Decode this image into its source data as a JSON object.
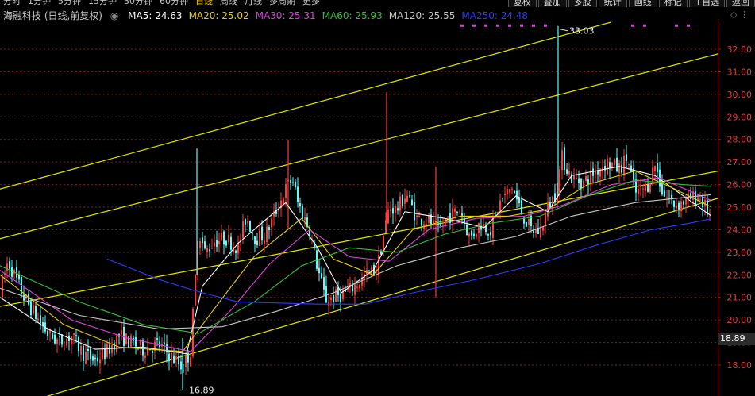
{
  "header": {
    "period_tabs": [
      "分时",
      "1分钟",
      "5分钟",
      "15分钟",
      "30分钟",
      "60分钟",
      "日线",
      "周线",
      "月线",
      "多周期",
      "更多"
    ],
    "active_tab": "日线",
    "tools": [
      "复权",
      "叠加",
      "多股",
      "统计",
      "画线",
      "标记",
      "+自选",
      "返回"
    ]
  },
  "legend": {
    "title": "海融科技 (日线,前复权)",
    "items": [
      {
        "label": "MA5: 24.63",
        "color": "#ffffff"
      },
      {
        "label": "MA20: 25.02",
        "color": "#e8d000"
      },
      {
        "label": "MA30: 25.31",
        "color": "#e040e0"
      },
      {
        "label": "MA60: 25.93",
        "color": "#30c030"
      },
      {
        "label": "MA120: 25.55",
        "color": "#c8c8c8"
      },
      {
        "label": "MA250: 24.48",
        "color": "#2a3cff"
      }
    ]
  },
  "price_tag": "18.89",
  "chart_data": {
    "type": "candlestick",
    "ylim": [
      17.0,
      33.5
    ],
    "y_ticks": [
      "18.00",
      "19.00",
      "20.00",
      "21.00",
      "22.00",
      "23.00",
      "24.00",
      "25.00",
      "26.00",
      "27.00",
      "28.00",
      "29.00",
      "30.00",
      "31.00",
      "32.00"
    ],
    "annotations": {
      "high": "33.03",
      "low": "16.89"
    },
    "colors": {
      "up": "#ff3b3b",
      "down": "#54ffff",
      "grid": "#7a1f1f",
      "channel": "#e6e600"
    },
    "price_path": [
      [
        0,
        21.2
      ],
      [
        10,
        22.6
      ],
      [
        18,
        22.0
      ],
      [
        30,
        21.0
      ],
      [
        45,
        20.2
      ],
      [
        60,
        19.4
      ],
      [
        75,
        19.0
      ],
      [
        90,
        19.3
      ],
      [
        105,
        18.5
      ],
      [
        120,
        18.2
      ],
      [
        135,
        18.6
      ],
      [
        150,
        19.3
      ],
      [
        165,
        19.0
      ],
      [
        180,
        18.7
      ],
      [
        200,
        18.9
      ],
      [
        215,
        18.4
      ],
      [
        230,
        17.9
      ],
      [
        240,
        18.6
      ],
      [
        250,
        24.0
      ],
      [
        258,
        23.0
      ],
      [
        270,
        23.5
      ],
      [
        285,
        23.6
      ],
      [
        300,
        23.2
      ],
      [
        310,
        24.6
      ],
      [
        322,
        23.6
      ],
      [
        335,
        23.8
      ],
      [
        345,
        24.6
      ],
      [
        360,
        25.8
      ],
      [
        368,
        26.3
      ],
      [
        375,
        25.2
      ],
      [
        390,
        24.0
      ],
      [
        400,
        22.3
      ],
      [
        410,
        20.9
      ],
      [
        420,
        21.0
      ],
      [
        435,
        21.2
      ],
      [
        450,
        21.6
      ],
      [
        462,
        22.0
      ],
      [
        475,
        22.3
      ],
      [
        480,
        23.2
      ],
      [
        490,
        25.0
      ],
      [
        500,
        24.9
      ],
      [
        512,
        25.6
      ],
      [
        525,
        24.5
      ],
      [
        540,
        24.4
      ],
      [
        552,
        23.9
      ],
      [
        565,
        24.6
      ],
      [
        580,
        24.9
      ],
      [
        592,
        23.6
      ],
      [
        605,
        24.3
      ],
      [
        618,
        24.0
      ],
      [
        630,
        25.2
      ],
      [
        645,
        25.9
      ],
      [
        655,
        24.9
      ],
      [
        668,
        24.0
      ],
      [
        680,
        23.9
      ],
      [
        690,
        25.0
      ],
      [
        700,
        25.6
      ],
      [
        708,
        27.2
      ],
      [
        720,
        26.3
      ],
      [
        735,
        26.1
      ],
      [
        750,
        26.6
      ],
      [
        765,
        27.0
      ],
      [
        780,
        26.7
      ],
      [
        790,
        27.2
      ],
      [
        800,
        25.6
      ],
      [
        815,
        25.9
      ],
      [
        825,
        26.9
      ],
      [
        835,
        25.6
      ],
      [
        850,
        25.1
      ],
      [
        865,
        25.3
      ],
      [
        880,
        25.5
      ],
      [
        890,
        24.9
      ],
      [
        895,
        24.6
      ]
    ],
    "spikes": [
      [
        248,
        27.6,
        22.0
      ],
      [
        363,
        28.0,
        24.0
      ],
      [
        487,
        30.1,
        24.0
      ],
      [
        703,
        33.03,
        25.5
      ],
      [
        549,
        26.8,
        21.0
      ],
      [
        230,
        19.2,
        16.89
      ]
    ],
    "channel_lines": [
      [
        [
          0,
          20.6
        ],
        [
          905,
          26.6
        ]
      ],
      [
        [
          0,
          16.0
        ],
        [
          905,
          25.4
        ]
      ],
      [
        [
          0,
          23.6
        ],
        [
          905,
          31.8
        ]
      ],
      [
        [
          0,
          25.8
        ],
        [
          770,
          33.2
        ]
      ]
    ],
    "series": [
      {
        "name": "MA5",
        "color": "#ffffff",
        "values": [
          [
            0,
            21.0
          ],
          [
            60,
            19.6
          ],
          [
            120,
            18.7
          ],
          [
            180,
            18.8
          ],
          [
            235,
            18.5
          ],
          [
            255,
            21.5
          ],
          [
            300,
            23.4
          ],
          [
            360,
            25.2
          ],
          [
            400,
            23.2
          ],
          [
            430,
            21.2
          ],
          [
            470,
            22.2
          ],
          [
            510,
            24.8
          ],
          [
            560,
            24.5
          ],
          [
            610,
            24.1
          ],
          [
            650,
            25.5
          ],
          [
            690,
            24.8
          ],
          [
            720,
            26.4
          ],
          [
            780,
            26.8
          ],
          [
            825,
            26.4
          ],
          [
            895,
            24.63
          ]
        ]
      },
      {
        "name": "MA20",
        "color": "#e8d000",
        "values": [
          [
            0,
            22.0
          ],
          [
            80,
            19.8
          ],
          [
            150,
            18.8
          ],
          [
            230,
            18.6
          ],
          [
            270,
            20.5
          ],
          [
            320,
            22.8
          ],
          [
            380,
            24.5
          ],
          [
            420,
            22.7
          ],
          [
            470,
            22.0
          ],
          [
            520,
            24.0
          ],
          [
            580,
            24.6
          ],
          [
            640,
            24.6
          ],
          [
            690,
            24.9
          ],
          [
            740,
            26.0
          ],
          [
            800,
            26.6
          ],
          [
            850,
            25.8
          ],
          [
            895,
            25.02
          ]
        ]
      },
      {
        "name": "MA30",
        "color": "#e040e0",
        "values": [
          [
            0,
            22.2
          ],
          [
            90,
            20.0
          ],
          [
            160,
            19.2
          ],
          [
            240,
            18.6
          ],
          [
            290,
            20.4
          ],
          [
            340,
            22.5
          ],
          [
            390,
            24.0
          ],
          [
            440,
            22.8
          ],
          [
            490,
            22.6
          ],
          [
            540,
            24.0
          ],
          [
            600,
            24.5
          ],
          [
            660,
            24.6
          ],
          [
            710,
            25.1
          ],
          [
            770,
            26.0
          ],
          [
            830,
            26.3
          ],
          [
            895,
            25.31
          ]
        ]
      },
      {
        "name": "MA60",
        "color": "#30c030",
        "values": [
          [
            0,
            22.4
          ],
          [
            100,
            20.8
          ],
          [
            180,
            19.8
          ],
          [
            250,
            19.4
          ],
          [
            320,
            20.8
          ],
          [
            380,
            22.4
          ],
          [
            440,
            23.2
          ],
          [
            500,
            23.0
          ],
          [
            560,
            23.8
          ],
          [
            620,
            24.3
          ],
          [
            680,
            24.6
          ],
          [
            740,
            25.5
          ],
          [
            800,
            26.2
          ],
          [
            860,
            26.0
          ],
          [
            895,
            25.93
          ]
        ]
      },
      {
        "name": "MA120",
        "color": "#c8c8c8",
        "values": [
          [
            0,
            21.4
          ],
          [
            100,
            20.2
          ],
          [
            200,
            19.6
          ],
          [
            280,
            19.7
          ],
          [
            350,
            20.4
          ],
          [
            420,
            21.2
          ],
          [
            500,
            22.4
          ],
          [
            580,
            23.2
          ],
          [
            650,
            23.7
          ],
          [
            720,
            24.6
          ],
          [
            800,
            25.2
          ],
          [
            895,
            25.55
          ]
        ]
      },
      {
        "name": "MA250",
        "color": "#2a3cff",
        "values": [
          [
            135,
            22.7
          ],
          [
            200,
            21.8
          ],
          [
            245,
            21.3
          ],
          [
            300,
            20.8
          ],
          [
            400,
            20.7
          ],
          [
            460,
            20.7
          ],
          [
            520,
            21.2
          ],
          [
            600,
            21.8
          ],
          [
            680,
            22.5
          ],
          [
            750,
            23.3
          ],
          [
            820,
            24.0
          ],
          [
            870,
            24.3
          ],
          [
            895,
            24.48
          ]
        ]
      }
    ],
    "markers": {
      "color": "#e040e0",
      "x": [
        580,
        595,
        610,
        625,
        640,
        655,
        670,
        685,
        795,
        810,
        850,
        865
      ],
      "y": 33.1
    }
  }
}
